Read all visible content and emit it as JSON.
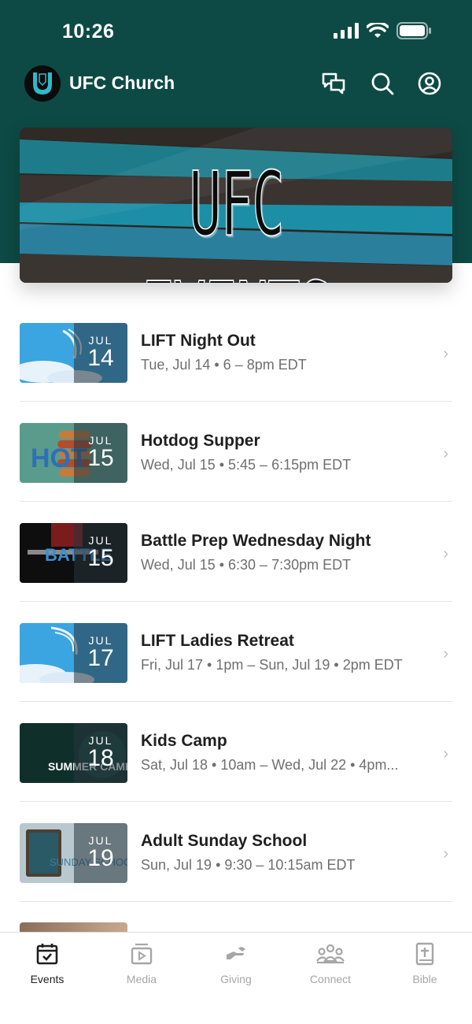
{
  "status": {
    "time": "10:26"
  },
  "app": {
    "title": "UFC Church"
  },
  "banner": {
    "text": "UFC EVENTS"
  },
  "events": [
    {
      "title": "LIFT Night Out",
      "subtitle": "Tue, Jul 14 • 6 – 8pm EDT",
      "month": "JUL",
      "day": "14",
      "thumb": "sky"
    },
    {
      "title": "Hotdog Supper",
      "subtitle": "Wed, Jul 15 • 5:45 – 6:15pm EDT",
      "month": "JUL",
      "day": "15",
      "thumb": "hotdog"
    },
    {
      "title": "Battle Prep Wednesday Night",
      "subtitle": "Wed, Jul 15 • 6:30 – 7:30pm EDT",
      "month": "JUL",
      "day": "15",
      "thumb": "battle"
    },
    {
      "title": "LIFT Ladies Retreat",
      "subtitle": "Fri, Jul 17 • 1pm – Sun, Jul 19 • 2pm EDT",
      "month": "JUL",
      "day": "17",
      "thumb": "sky"
    },
    {
      "title": "Kids Camp",
      "subtitle": "Sat, Jul 18 • 10am – Wed, Jul 22 • 4pm...",
      "month": "JUL",
      "day": "18",
      "thumb": "camp"
    },
    {
      "title": "Adult Sunday School",
      "subtitle": "Sun, Jul 19 • 9:30 – 10:15am EDT",
      "month": "JUL",
      "day": "19",
      "thumb": "school"
    }
  ],
  "thumb_text": {
    "hotdog": "HOT",
    "battle": "BATTLE",
    "camp": "SUMMER CAMP",
    "school": "SUNDAY SCHOOL"
  },
  "tabs": [
    {
      "label": "Events",
      "icon": "calendar-icon",
      "active": true
    },
    {
      "label": "Media",
      "icon": "media-icon",
      "active": false
    },
    {
      "label": "Giving",
      "icon": "giving-icon",
      "active": false
    },
    {
      "label": "Connect",
      "icon": "people-icon",
      "active": false
    },
    {
      "label": "Bible",
      "icon": "bible-icon",
      "active": false
    }
  ],
  "colors": {
    "header_bg": "#0d4a45",
    "accent_teal": "#2a9fb0"
  }
}
